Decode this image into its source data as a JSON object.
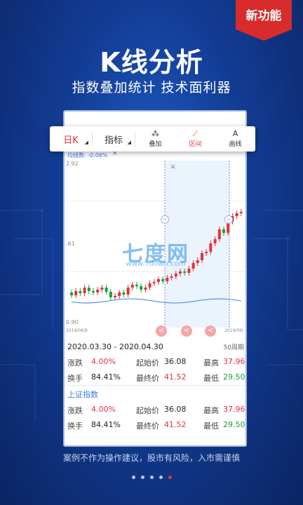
{
  "badge": {
    "label": "新功能",
    "color": "#d82b2b"
  },
  "hero": {
    "title": "K线分析",
    "subtitle": "指数叠加统计  技术面利器"
  },
  "toolbar": {
    "tabs": [
      {
        "label": "日K",
        "active": true
      },
      {
        "label": "指标",
        "active": false
      }
    ],
    "tools": [
      {
        "label": "叠加",
        "icon": "overlay-icon",
        "active": false
      },
      {
        "label": "区间",
        "icon": "range-chart-icon",
        "active": true
      },
      {
        "label": "画线",
        "icon": "draw-line-icon",
        "active": false
      }
    ]
  },
  "chart": {
    "ma_label": "均线数: -0.06%",
    "close_icon": "×",
    "y_labels": [
      "2.92",
      ".61",
      "0.90"
    ],
    "x_labels": [
      "2019/06/8",
      "2019/09/"
    ],
    "range_nav": [
      "<",
      "<",
      "<"
    ],
    "range_handle": "‹›"
  },
  "watermark": {
    "title": "七度网",
    "sub": "www.7down.com"
  },
  "period": {
    "dates": "2020.03.30 - 2020.04.30",
    "period_label": "50周期"
  },
  "stats_primary": {
    "change_label": "涨跌",
    "change_value": "4.00%",
    "start_label": "起始价",
    "start_value": "36.08",
    "high_label": "最高",
    "high_value": "37.96",
    "turnover_label": "换手",
    "turnover_value": "84.41%",
    "end_label": "最终价",
    "end_value": "41.52",
    "low_label": "最低",
    "low_value": "29.50"
  },
  "index": {
    "name": "上证指数",
    "change_label": "涨跌",
    "change_value": "4.00%",
    "start_label": "起始价",
    "start_value": "36.08",
    "high_label": "最高",
    "high_value": "37.96",
    "turnover_label": "换手",
    "turnover_value": "84.41%",
    "end_label": "最终价",
    "end_value": "41.52",
    "low_label": "最低",
    "low_value": "29.50"
  },
  "disclaimer": "案例不作为操作建议，股市有风险，入市需谨慎",
  "pagination": {
    "count": 5,
    "active_index": 4
  },
  "colors": {
    "up": "#e2333a",
    "down": "#19a23a",
    "accent": "#3a7ee0"
  }
}
